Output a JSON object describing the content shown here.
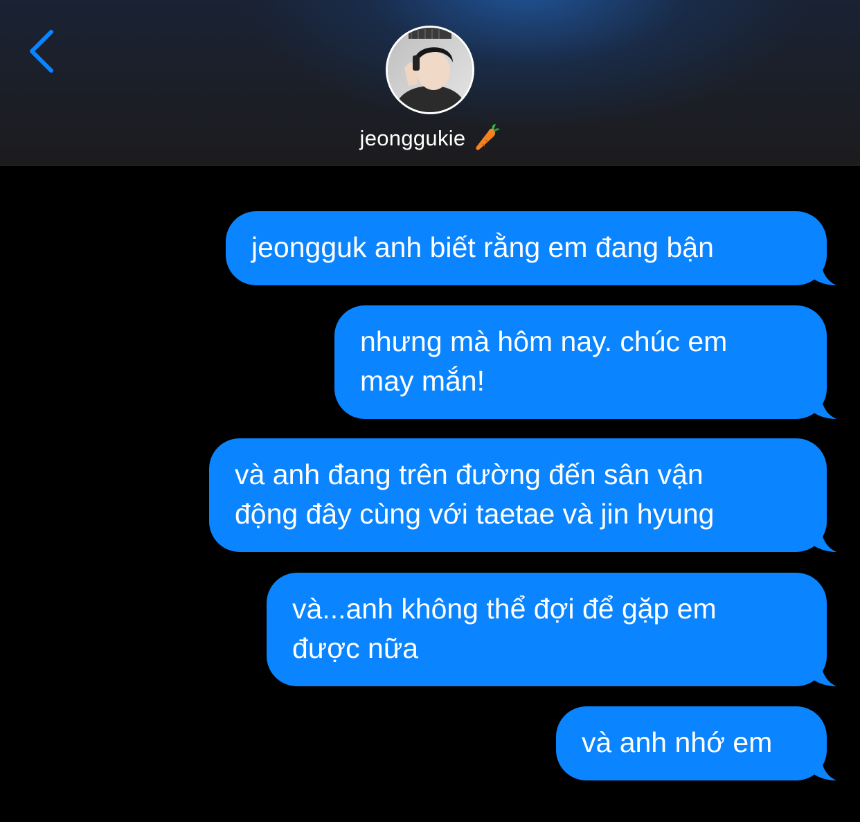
{
  "header": {
    "contact_name": "jeonggukie",
    "contact_emoji_icon": "carrot-icon",
    "back_icon": "chevron-left-icon",
    "accent_color": "#0a84ff"
  },
  "messages": [
    {
      "text": "jeongguk anh biết rằng em đang bận",
      "sender": "me"
    },
    {
      "text": "nhưng mà hôm nay. chúc em\nmay mắn!",
      "sender": "me"
    },
    {
      "text": "và anh đang trên đường đến sân vận\nđộng đây cùng với taetae và jin hyung",
      "sender": "me"
    },
    {
      "text": "và...anh không thể đợi để gặp em\nđược nữa",
      "sender": "me"
    },
    {
      "text": "và anh nhớ em",
      "sender": "me"
    }
  ],
  "colors": {
    "bubble_blue": "#0a84ff",
    "background": "#000000",
    "header_bg": "#1c1c1e"
  }
}
